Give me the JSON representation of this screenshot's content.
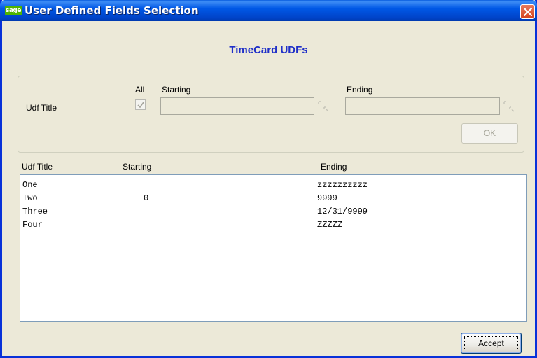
{
  "window": {
    "title": "User Defined Fields Selection",
    "logo_text": "sage"
  },
  "heading": "TimeCard UDFs",
  "filter": {
    "row_label": "Udf Title",
    "all_label": "All",
    "all_checked": true,
    "starting_label": "Starting",
    "ending_label": "Ending",
    "starting_value": "",
    "ending_value": "",
    "ok_label": "OK"
  },
  "list": {
    "columns": [
      "Udf Title",
      "Starting",
      "Ending"
    ],
    "rows": [
      {
        "title": "One",
        "starting": "",
        "ending": "zzzzzzzzzz"
      },
      {
        "title": "Two",
        "starting": "0",
        "ending": "9999"
      },
      {
        "title": "Three",
        "starting": "",
        "ending": "12/31/9999"
      },
      {
        "title": "Four",
        "starting": "",
        "ending": "ZZZZZ"
      }
    ]
  },
  "footer": {
    "accept_label": "Accept"
  },
  "colors": {
    "titlebar": "#0058e6",
    "heading": "#1f2fc8",
    "window_bg": "#ece9d8"
  }
}
